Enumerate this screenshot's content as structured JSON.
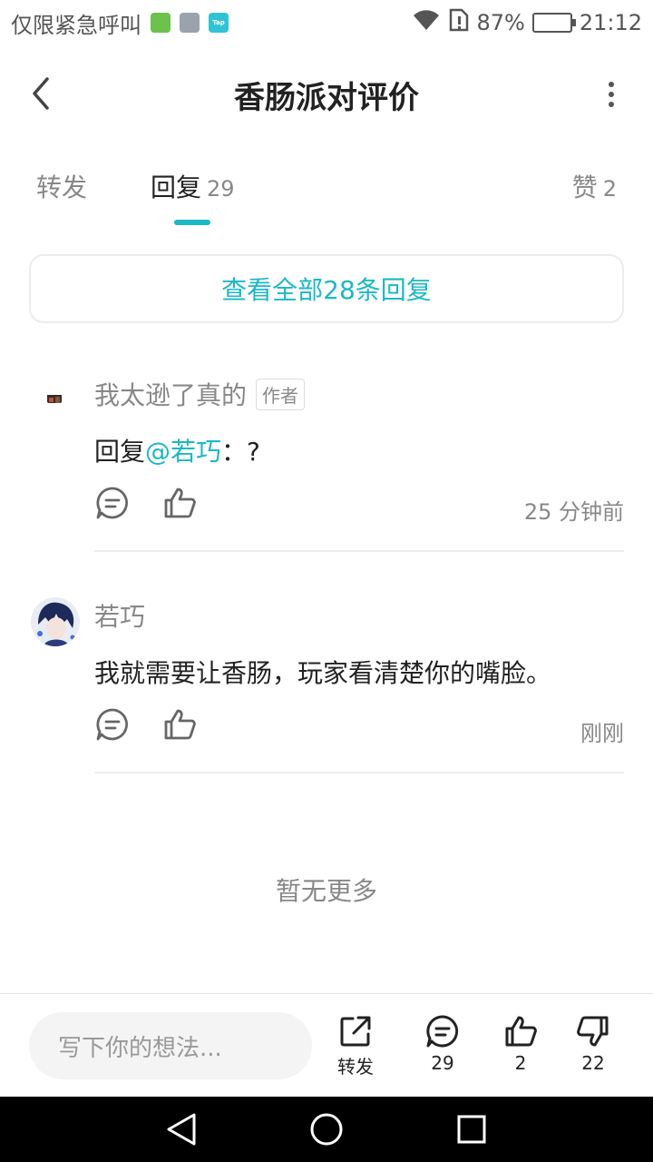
{
  "status_bar": {
    "carrier": "仅限紧急呼叫",
    "battery": "87%",
    "time": "21:12",
    "battery_level": 0.87,
    "app_icons": [
      "wechat-like-icon",
      "gallery-icon",
      "taptap-icon"
    ],
    "tap_label": "Tap"
  },
  "header": {
    "title": "香肠派对评价"
  },
  "tabs": {
    "repost": "转发",
    "reply": "回复",
    "reply_count": "29",
    "like": "赞",
    "like_count": "2"
  },
  "view_all": "查看全部28条回复",
  "comments": [
    {
      "username": "我太逊了真的",
      "badge": "作者",
      "prefix": "回复",
      "mention": "@若巧",
      "suffix": "：?",
      "time": "25 分钟前"
    },
    {
      "username": "若巧",
      "text": "我就需要让香肠，玩家看清楚你的嘴脸。",
      "time": "刚刚"
    }
  ],
  "no_more": "暂无更多",
  "bottom_bar": {
    "input_placeholder": "写下你的想法...",
    "repost_label": "转发",
    "reply_count": "29",
    "like_count": "2",
    "dislike_count": "22"
  },
  "colors": {
    "accent": "#1cb8c6",
    "text_primary": "#222222",
    "text_secondary": "#888888"
  }
}
